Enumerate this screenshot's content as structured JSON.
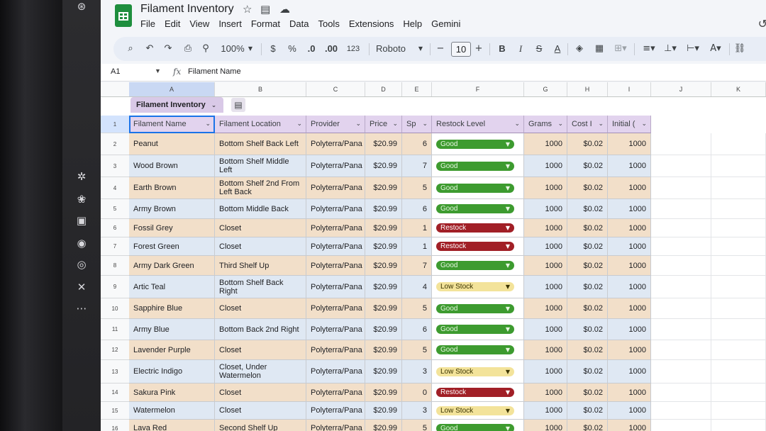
{
  "app": {
    "title": "Filament Inventory",
    "menu": [
      "File",
      "Edit",
      "View",
      "Insert",
      "Format",
      "Data",
      "Tools",
      "Extensions",
      "Help",
      "Gemini"
    ]
  },
  "toolbar": {
    "zoom": "100%",
    "currency": "$",
    "percent": "%",
    "dec_decrease": ".0",
    "dec_increase": ".00",
    "number_format": "123",
    "font": "Roboto",
    "font_size": "10"
  },
  "formula_bar": {
    "cell_ref": "A1",
    "fx": "fx",
    "content": "Filament Name"
  },
  "grid": {
    "columns": [
      "A",
      "B",
      "C",
      "D",
      "E",
      "F",
      "G",
      "H",
      "I",
      "J",
      "K"
    ],
    "table_name": "Filament Inventory",
    "headers": [
      "Filament Name",
      "Filament Location",
      "Provider",
      "Price",
      "Sp",
      "Restock Level",
      "Grams",
      "Cost I",
      "Initial ("
    ],
    "rows": [
      {
        "num": "1"
      },
      {
        "num": "2",
        "name": "Peanut",
        "location": "Bottom Shelf Back Left",
        "provider": "Polyterra/Pana",
        "price": "$20.99",
        "spools": "6",
        "status": "Good",
        "status_type": "good",
        "grams": "1000",
        "cost": "$0.02",
        "initial": "1000"
      },
      {
        "num": "3",
        "name": "Wood Brown",
        "location": "Bottom Shelf Middle Left",
        "provider": "Polyterra/Pana",
        "price": "$20.99",
        "spools": "7",
        "status": "Good",
        "status_type": "good",
        "grams": "1000",
        "cost": "$0.02",
        "initial": "1000"
      },
      {
        "num": "4",
        "name": "Earth Brown",
        "location": "Bottom Shelf 2nd From Left Back",
        "provider": "Polyterra/Pana",
        "price": "$20.99",
        "spools": "5",
        "status": "Good",
        "status_type": "good",
        "grams": "1000",
        "cost": "$0.02",
        "initial": "1000"
      },
      {
        "num": "5",
        "name": "Army Brown",
        "location": "Bottom Middle Back",
        "provider": "Polyterra/Pana",
        "price": "$20.99",
        "spools": "6",
        "status": "Good",
        "status_type": "good",
        "grams": "1000",
        "cost": "$0.02",
        "initial": "1000"
      },
      {
        "num": "6",
        "name": "Fossil Grey",
        "location": "Closet",
        "provider": "Polyterra/Pana",
        "price": "$20.99",
        "spools": "1",
        "status": "Restock",
        "status_type": "restock",
        "grams": "1000",
        "cost": "$0.02",
        "initial": "1000"
      },
      {
        "num": "7",
        "name": "Forest Green",
        "location": "Closet",
        "provider": "Polyterra/Pana",
        "price": "$20.99",
        "spools": "1",
        "status": "Restock",
        "status_type": "restock",
        "grams": "1000",
        "cost": "$0.02",
        "initial": "1000"
      },
      {
        "num": "8",
        "name": "Army Dark Green",
        "location": "Third Shelf Up",
        "provider": "Polyterra/Pana",
        "price": "$20.99",
        "spools": "7",
        "status": "Good",
        "status_type": "good",
        "grams": "1000",
        "cost": "$0.02",
        "initial": "1000"
      },
      {
        "num": "9",
        "name": "Artic Teal",
        "location": "Bottom Shelf Back Right",
        "provider": "Polyterra/Pana",
        "price": "$20.99",
        "spools": "4",
        "status": "Low Stock",
        "status_type": "low",
        "grams": "1000",
        "cost": "$0.02",
        "initial": "1000"
      },
      {
        "num": "10",
        "name": "Sapphire Blue",
        "location": "Closet",
        "provider": "Polyterra/Pana",
        "price": "$20.99",
        "spools": "5",
        "status": "Good",
        "status_type": "good",
        "grams": "1000",
        "cost": "$0.02",
        "initial": "1000"
      },
      {
        "num": "11",
        "name": "Army Blue",
        "location": "Bottom Back 2nd Right",
        "provider": "Polyterra/Pana",
        "price": "$20.99",
        "spools": "6",
        "status": "Good",
        "status_type": "good",
        "grams": "1000",
        "cost": "$0.02",
        "initial": "1000"
      },
      {
        "num": "12",
        "name": "Lavender Purple",
        "location": "Closet",
        "provider": "Polyterra/Pana",
        "price": "$20.99",
        "spools": "5",
        "status": "Good",
        "status_type": "good",
        "grams": "1000",
        "cost": "$0.02",
        "initial": "1000"
      },
      {
        "num": "13",
        "name": "Electric Indigo",
        "location": "Closet, Under Watermelon",
        "provider": "Polyterra/Pana",
        "price": "$20.99",
        "spools": "3",
        "status": "Low Stock",
        "status_type": "low",
        "grams": "1000",
        "cost": "$0.02",
        "initial": "1000"
      },
      {
        "num": "14",
        "name": "Sakura Pink",
        "location": "Closet",
        "provider": "Polyterra/Pana",
        "price": "$20.99",
        "spools": "0",
        "status": "Restock",
        "status_type": "restock",
        "grams": "1000",
        "cost": "$0.02",
        "initial": "1000"
      },
      {
        "num": "15",
        "name": "Watermelon",
        "location": "Closet",
        "provider": "Polyterra/Pana",
        "price": "$20.99",
        "spools": "3",
        "status": "Low Stock",
        "status_type": "low",
        "grams": "1000",
        "cost": "$0.02",
        "initial": "1000"
      },
      {
        "num": "16",
        "name": "Lava Red",
        "location": "Second Shelf Up",
        "provider": "Polyterra/Pana",
        "price": "$20.99",
        "spools": "5",
        "status": "Good",
        "status_type": "good",
        "grams": "1000",
        "cost": "$0.02",
        "initial": "1000"
      }
    ]
  },
  "colors": {
    "header_bg": "#e2d3ee",
    "band_even": "#dfe8f3",
    "band_odd": "#f2dfc9",
    "good": "#3d9b2f",
    "restock": "#a11f26",
    "low_stock": "#f3e39a"
  },
  "icons": [
    "search-icon",
    "undo-icon",
    "redo-icon",
    "print-icon",
    "paint-format-icon",
    "star-icon",
    "folder-icon",
    "cloud-icon"
  ]
}
